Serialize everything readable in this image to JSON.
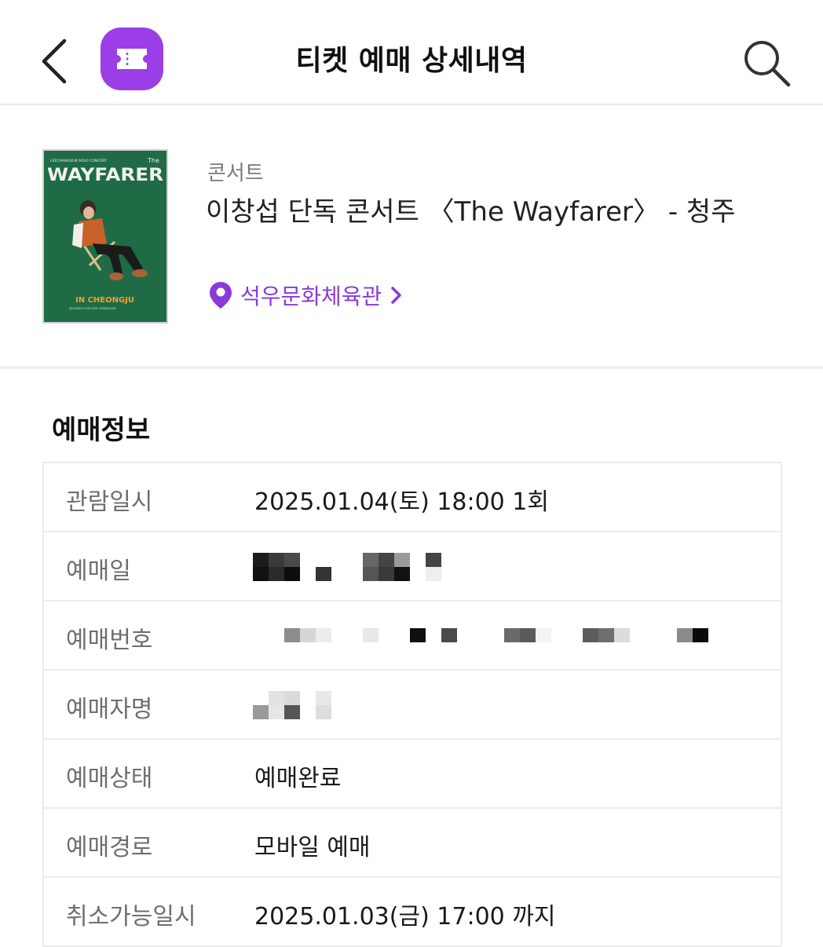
{
  "header": {
    "title": "티켓 예매 상세내역",
    "app_icon": "ticket-icon",
    "accent_color": "#9b3ee8"
  },
  "event": {
    "category": "콘서트",
    "title": "이창섭 단독 콘서트 〈The Wayfarer〉 - 청주",
    "venue": "석우문화체육관",
    "venue_color": "#8a3ad8",
    "poster": {
      "top_text": "LEECHANGSUB SOLO CONCERT",
      "the_text": "The",
      "title_text": "WAYFARER",
      "bottom_text": "IN CHEONGJU",
      "sub_text": "SEOKWOO CULTURE GYMNASIUM",
      "bg_color": "#1e6b45"
    }
  },
  "booking": {
    "section_title": "예매정보",
    "rows": [
      {
        "label": "관람일시",
        "value": "2025.01.04(토) 18:00 1회"
      },
      {
        "label": "예매일",
        "value": ""
      },
      {
        "label": "예매번호",
        "value": ""
      },
      {
        "label": "예매자명",
        "value": ""
      },
      {
        "label": "예매상태",
        "value": "예매완료"
      },
      {
        "label": "예매경로",
        "value": "모바일 예매"
      },
      {
        "label": "취소가능일시",
        "value": "2025.01.03(금) 17:00 까지"
      }
    ]
  }
}
